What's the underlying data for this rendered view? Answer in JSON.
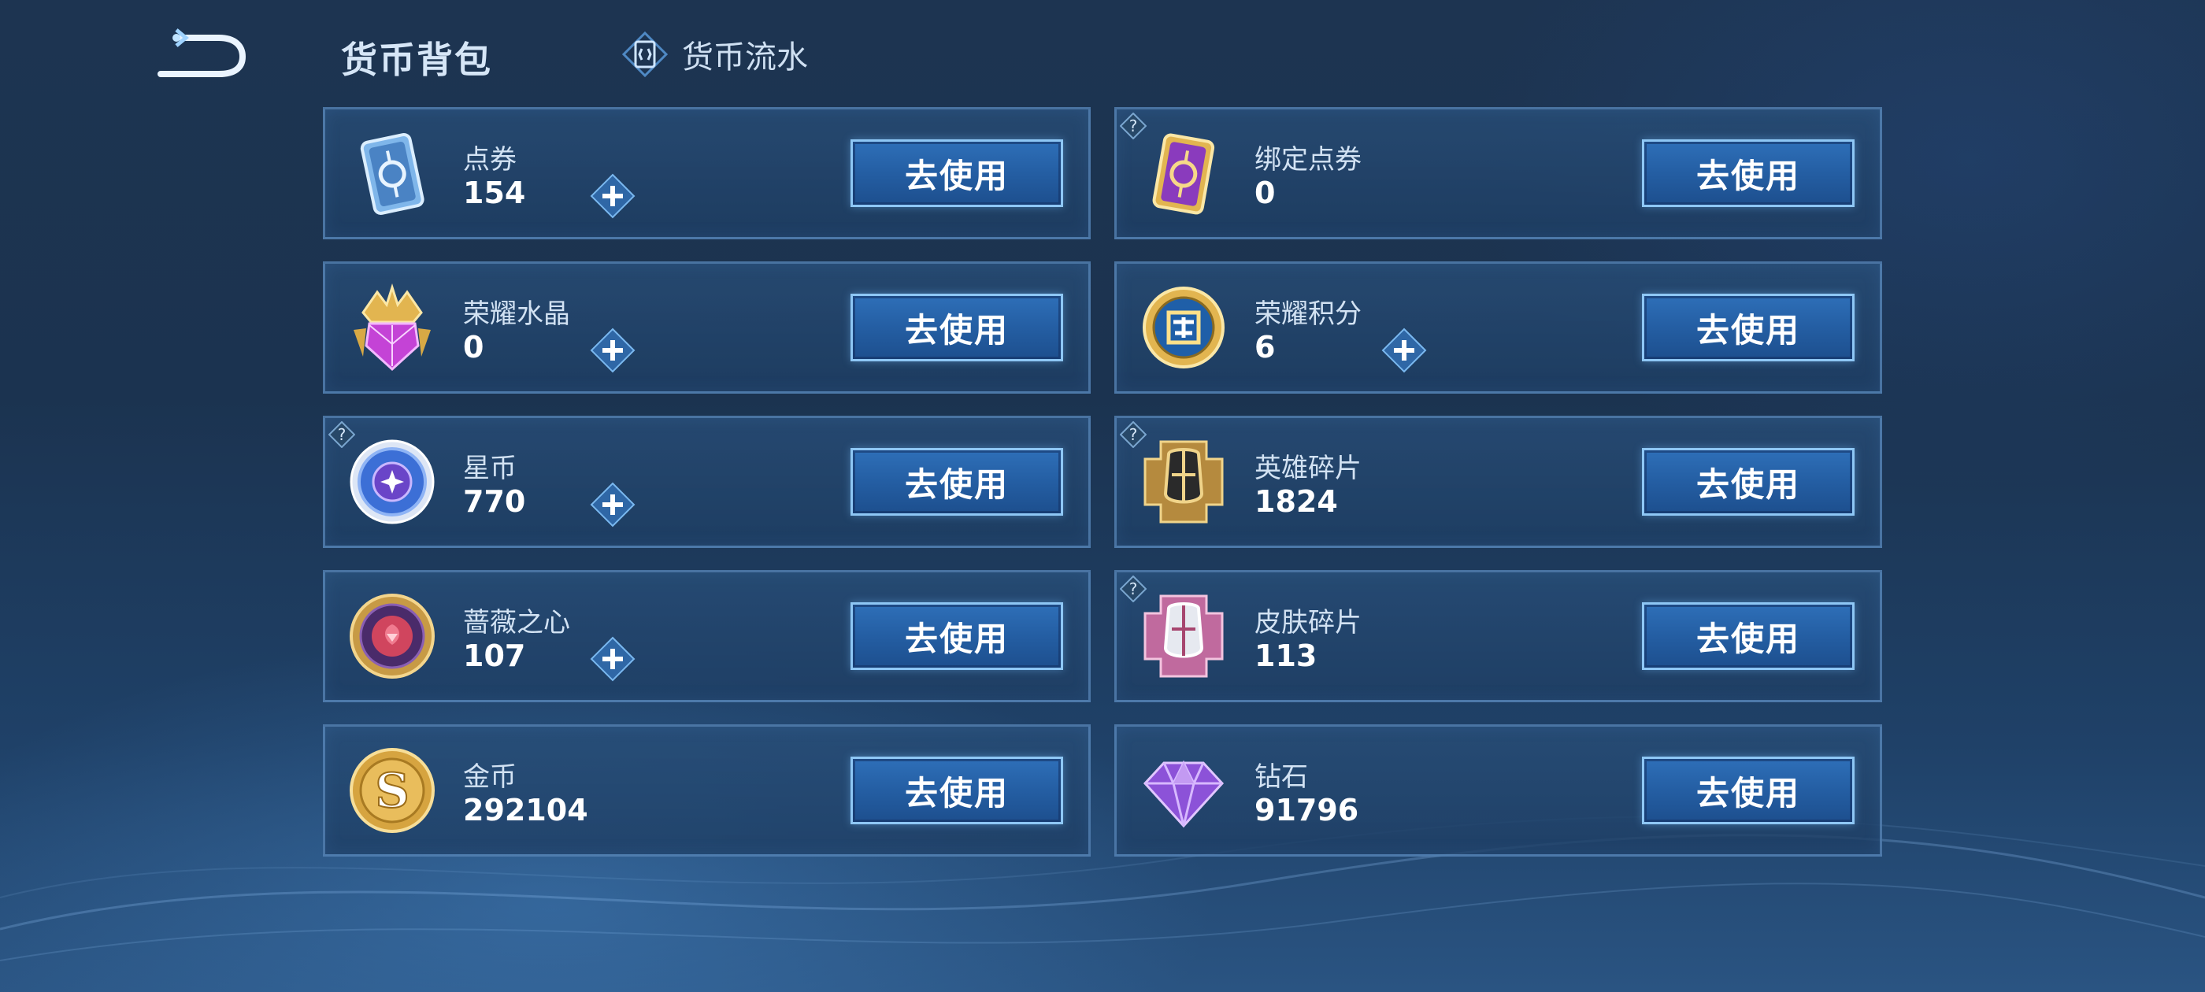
{
  "header": {
    "title": "货币背包",
    "flow_tab_label": "货币流水"
  },
  "currencies": [
    {
      "name": "点券",
      "value": "154",
      "icon": "coupon-icon",
      "help": false,
      "plus": true
    },
    {
      "name": "绑定点券",
      "value": "0",
      "icon": "bound-coupon-icon",
      "help": true,
      "plus": false
    },
    {
      "name": "荣耀水晶",
      "value": "0",
      "icon": "glory-crystal-icon",
      "help": false,
      "plus": true
    },
    {
      "name": "荣耀积分",
      "value": "6",
      "icon": "glory-points-icon",
      "help": false,
      "plus": true
    },
    {
      "name": "星币",
      "value": "770",
      "icon": "star-coin-icon",
      "help": true,
      "plus": true
    },
    {
      "name": "英雄碎片",
      "value": "1824",
      "icon": "hero-fragment-icon",
      "help": true,
      "plus": false
    },
    {
      "name": "蔷薇之心",
      "value": "107",
      "icon": "rose-heart-icon",
      "help": false,
      "plus": true
    },
    {
      "name": "皮肤碎片",
      "value": "113",
      "icon": "skin-fragment-icon",
      "help": true,
      "plus": false
    },
    {
      "name": "金币",
      "value": "292104",
      "icon": "gold-coin-icon",
      "help": false,
      "plus": false
    },
    {
      "name": "钻石",
      "value": "91796",
      "icon": "diamond-icon",
      "help": false,
      "plus": false
    }
  ],
  "use_button_label": "去使用",
  "colors": {
    "button": "#2662a8",
    "button_border": "#8ec7f5",
    "card_border": "#6ea0d7",
    "gold": "#e2b550",
    "purple": "#a44bd6"
  }
}
